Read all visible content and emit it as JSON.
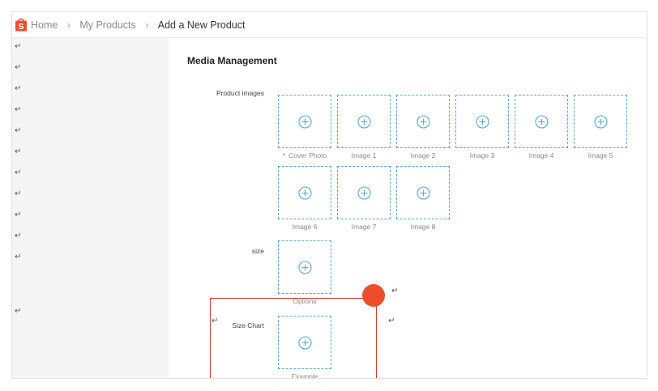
{
  "breadcrumb": {
    "items": [
      "Home",
      "My Products",
      "Add a New Product"
    ],
    "separator": "›"
  },
  "logo": {
    "letter": "S",
    "color": "#ee4d2d"
  },
  "return_glyph": "↵",
  "media": {
    "section_title": "Media Management",
    "product_images": {
      "label": "Product images",
      "required_mark": "*",
      "slots": [
        "Cover Photo",
        "Image 1",
        "Image 2",
        "Image 3",
        "Image 4",
        "Image 5",
        "Image 6",
        "Image 7",
        "Image 8"
      ]
    },
    "size": {
      "label": "size",
      "slot_caption": "Options"
    },
    "size_chart": {
      "label": "Size Chart",
      "slot_caption": "Example"
    }
  },
  "colors": {
    "accent": "#ee4d2d",
    "slot_border": "#5aa8cf",
    "highlight_border": "#cf3a2c"
  },
  "icons": {
    "upload": "plus-circle-icon",
    "logo": "shopee-bag-icon",
    "crumb_separator": "chevron-right-icon"
  }
}
